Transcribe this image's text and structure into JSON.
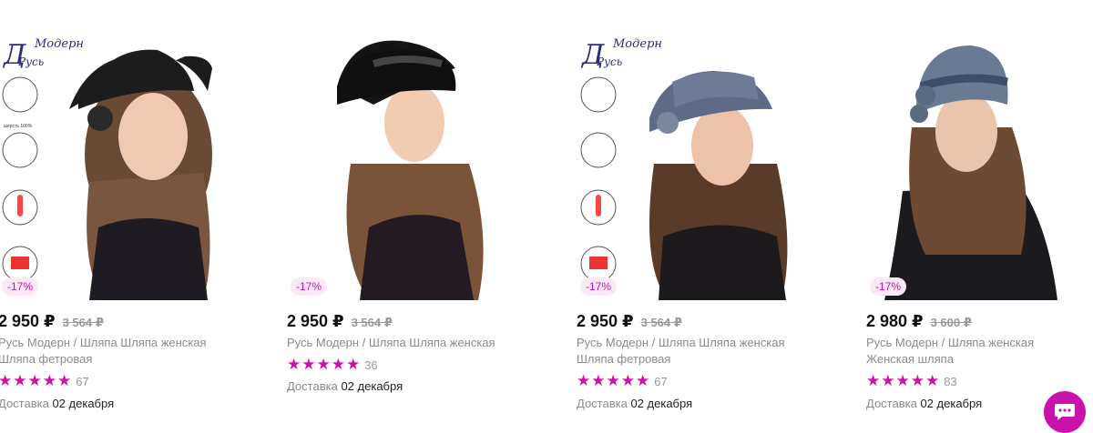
{
  "products": [
    {
      "price": "2 950 ₽",
      "old_price": "3 564 ₽",
      "discount": "-17%",
      "title_line1": "Русь Модерн / Шляпа Шляпа женская",
      "title_line2": "Шляпа фетровая",
      "rating_count": "67",
      "delivery_label": "Доставка",
      "delivery_date": "02 декабря",
      "hat_color": "#1c1c1c",
      "brand_logo": "Русь Модерн",
      "badges": [
        "шерсть 100%",
        "Российское производство",
        "от -15 до -15"
      ]
    },
    {
      "price": "2 950 ₽",
      "old_price": "3 564 ₽",
      "discount": "-17%",
      "title_line1": "Русь Модерн / Шляпа Шляпа женская",
      "title_line2": "",
      "rating_count": "36",
      "delivery_label": "Доставка",
      "delivery_date": "02 декабря",
      "hat_color": "#111111"
    },
    {
      "price": "2 950 ₽",
      "old_price": "3 564 ₽",
      "discount": "-17%",
      "title_line1": "Русь Модерн / Шляпа Шляпа женская",
      "title_line2": "Шляпа фетровая",
      "rating_count": "67",
      "delivery_label": "Доставка",
      "delivery_date": "02 декабря",
      "hat_color": "#5f6b86",
      "brand_logo": "Русь Модерн",
      "badges": [
        "шерсть 100%",
        "Российское производство",
        "от -15 до -15"
      ]
    },
    {
      "price": "2 980 ₽",
      "old_price": "3 600 ₽",
      "discount": "-17%",
      "title_line1": "Русь Модерн / Шляпа женская",
      "title_line2": "Женская шляпа",
      "rating_count": "83",
      "delivery_label": "Доставка",
      "delivery_date": "02 декабря",
      "hat_color": "#6a7a92"
    }
  ],
  "colors": {
    "accent": "#cb11ab",
    "star": "#cb11ab",
    "old_price": "#999999"
  },
  "chat_icon": "chat-icon"
}
